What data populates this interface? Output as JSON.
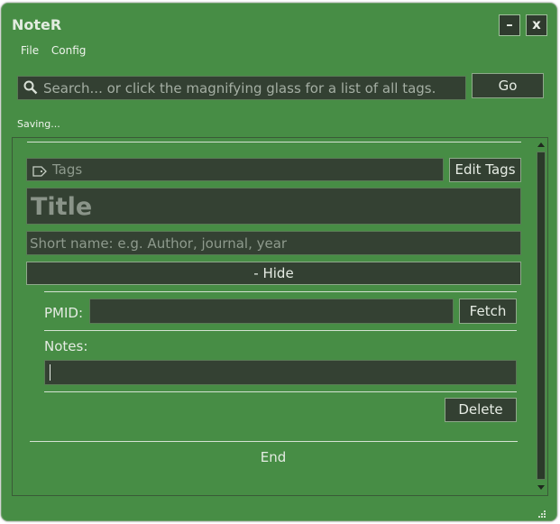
{
  "window": {
    "title": "NoteR",
    "minimize_label": "–",
    "close_label": "x"
  },
  "menu": {
    "items": [
      "File",
      "Config"
    ]
  },
  "search": {
    "placeholder": "Search... or click the magnifying glass for a list of all tags.",
    "go_label": "Go"
  },
  "status_text": "Saving...",
  "note": {
    "tags_placeholder": "Tags",
    "edit_tags_label": "Edit Tags",
    "title_placeholder": "Title",
    "short_name_placeholder": "Short name: e.g. Author, journal, year",
    "hide_label": "- Hide",
    "pmid_label": "PMID:",
    "pmid_value": "",
    "fetch_label": "Fetch",
    "notes_label": "Notes:",
    "notes_value": "",
    "delete_label": "Delete",
    "end_label": "End"
  },
  "colors": {
    "window_bg": "#478d45",
    "field_bg": "#344133",
    "text_light": "#e6ece4",
    "placeholder": "#8e9a8d"
  },
  "icons": [
    "search-icon",
    "tag-icon",
    "scroll-up-arrow-icon",
    "scroll-down-arrow-icon",
    "resize-grip-icon"
  ]
}
